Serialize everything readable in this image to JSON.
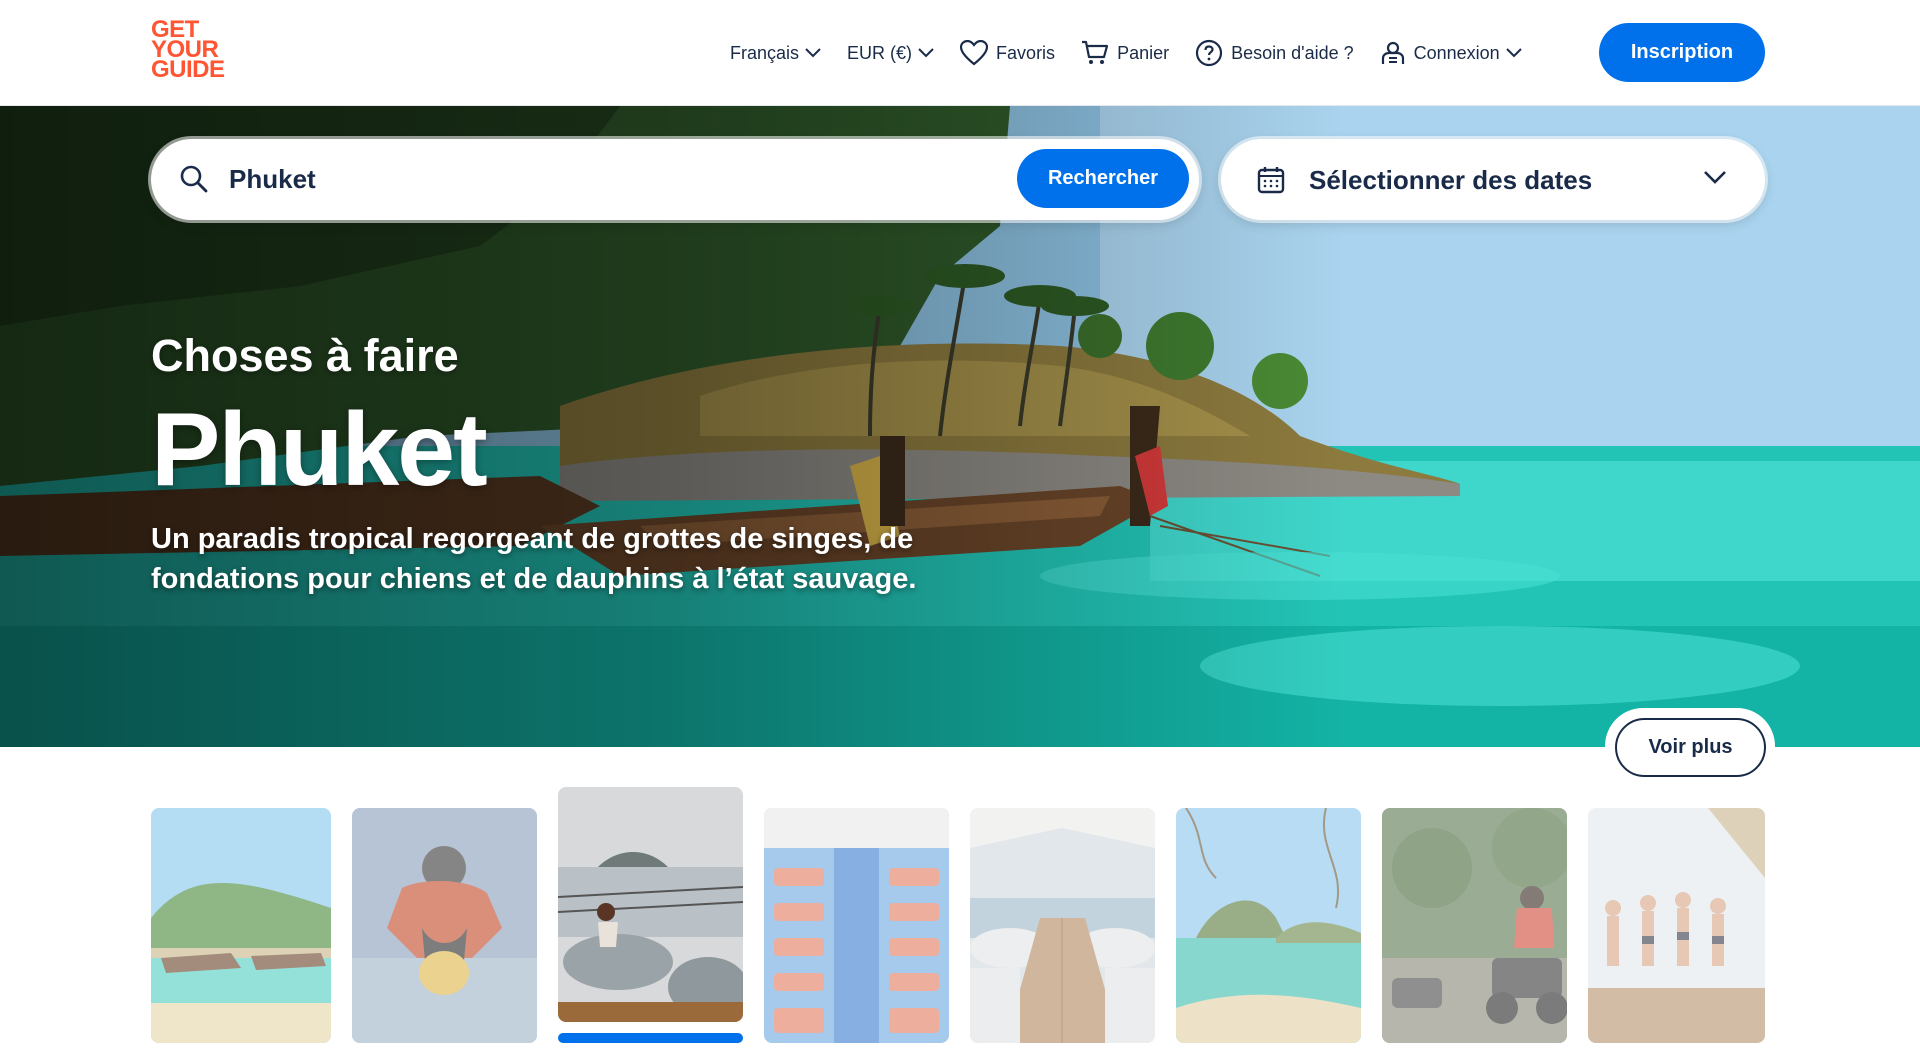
{
  "header": {
    "logo": [
      "GET",
      "YOUR",
      "GUIDE"
    ],
    "language": "Français",
    "currency": "EUR (€)",
    "favorites": "Favoris",
    "cart": "Panier",
    "help": "Besoin d'aide ?",
    "login": "Connexion",
    "signup": "Inscription"
  },
  "search": {
    "value": "Phuket",
    "button": "Rechercher",
    "dates": "Sélectionner des dates"
  },
  "hero": {
    "kicker": "Choses à faire",
    "title": "Phuket",
    "subtitle": "Un paradis tropical regorgeant de grottes de singes, de fondations pour chiens et de dauphins à l’état sauvage.",
    "see_more": "Voir plus"
  },
  "thumbnails": {
    "active_index": 2,
    "items": [
      {
        "subject": "beach-longtail-boats"
      },
      {
        "subject": "skydiving"
      },
      {
        "subject": "boat-deck-beanbags"
      },
      {
        "subject": "ferry-seats"
      },
      {
        "subject": "yacht-deck"
      },
      {
        "subject": "islands-bay"
      },
      {
        "subject": "atv-quad"
      },
      {
        "subject": "boat-party"
      }
    ]
  },
  "colors": {
    "brand": "#ff5533",
    "primary": "#0071eb",
    "text": "#1a2b49"
  }
}
